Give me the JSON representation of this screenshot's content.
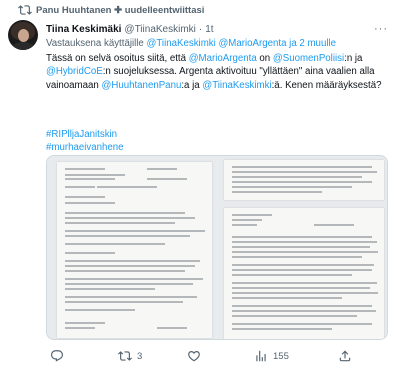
{
  "retweet_bar": {
    "text": "Panu Huuhtanen ✚ uudelleentwiittasi"
  },
  "tweet": {
    "author_name": "Tiina Keskimäki",
    "handle": "@TiinaKeskimki",
    "separator": "·",
    "time": "1t",
    "more": "···",
    "replying_prefix": "Vastauksena käyttäjille",
    "replying_handles": [
      "@TiinaKeskimki",
      "@MarioArgenta"
    ],
    "replying_others": "ja 2 muulle",
    "body": {
      "p1": "Tässä on selvä osoitus siitä, että",
      "m1": "@MarioArgenta",
      "p2": "on",
      "m2": "@SuomenPoliisi",
      "p3": ":n ja",
      "m3": "@HybridCoE",
      "p4": ":n suojeluksessa. Argenta aktivoituu \"yllättäen\" aina vaalien alla vainoamaan",
      "m4": "@HuuhtanenPanu",
      "p5": ":a ja",
      "m5": "@TiinaKeskimki",
      "p6": ":ä. Kenen määräyksestä?"
    },
    "hashtags": [
      "#RIPlljaJanitskin",
      "#murhaeivanhene"
    ]
  },
  "actions": {
    "reply": "",
    "retweets": "3",
    "likes": "",
    "views": "155"
  },
  "icons": {
    "retweet_bar": "retweet-icon",
    "reply": "reply-icon",
    "retweet": "retweet-icon",
    "like": "heart-icon",
    "views": "views-icon",
    "share": "share-icon"
  },
  "colors": {
    "link": "#1d9bf0",
    "muted": "#536471",
    "text": "#0f1419"
  }
}
